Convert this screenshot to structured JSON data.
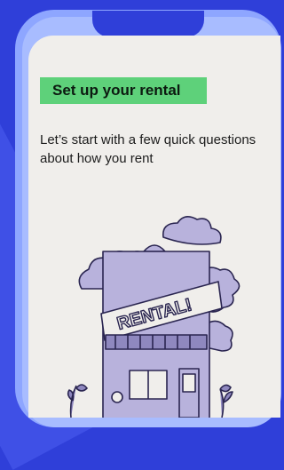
{
  "screen": {
    "title": "Set up your rental",
    "subtitle": "Let’s start with a few quick questions about how you rent"
  },
  "illustration": {
    "sign_text": "RENTAL!",
    "icon": "house-illustration"
  },
  "colors": {
    "background": "#2f3fd9",
    "phone_frame": "#8ea6ff",
    "screen": "#f0eeeb",
    "title_highlight": "#5ed17a",
    "illustration_fill": "#b8b2dc"
  }
}
